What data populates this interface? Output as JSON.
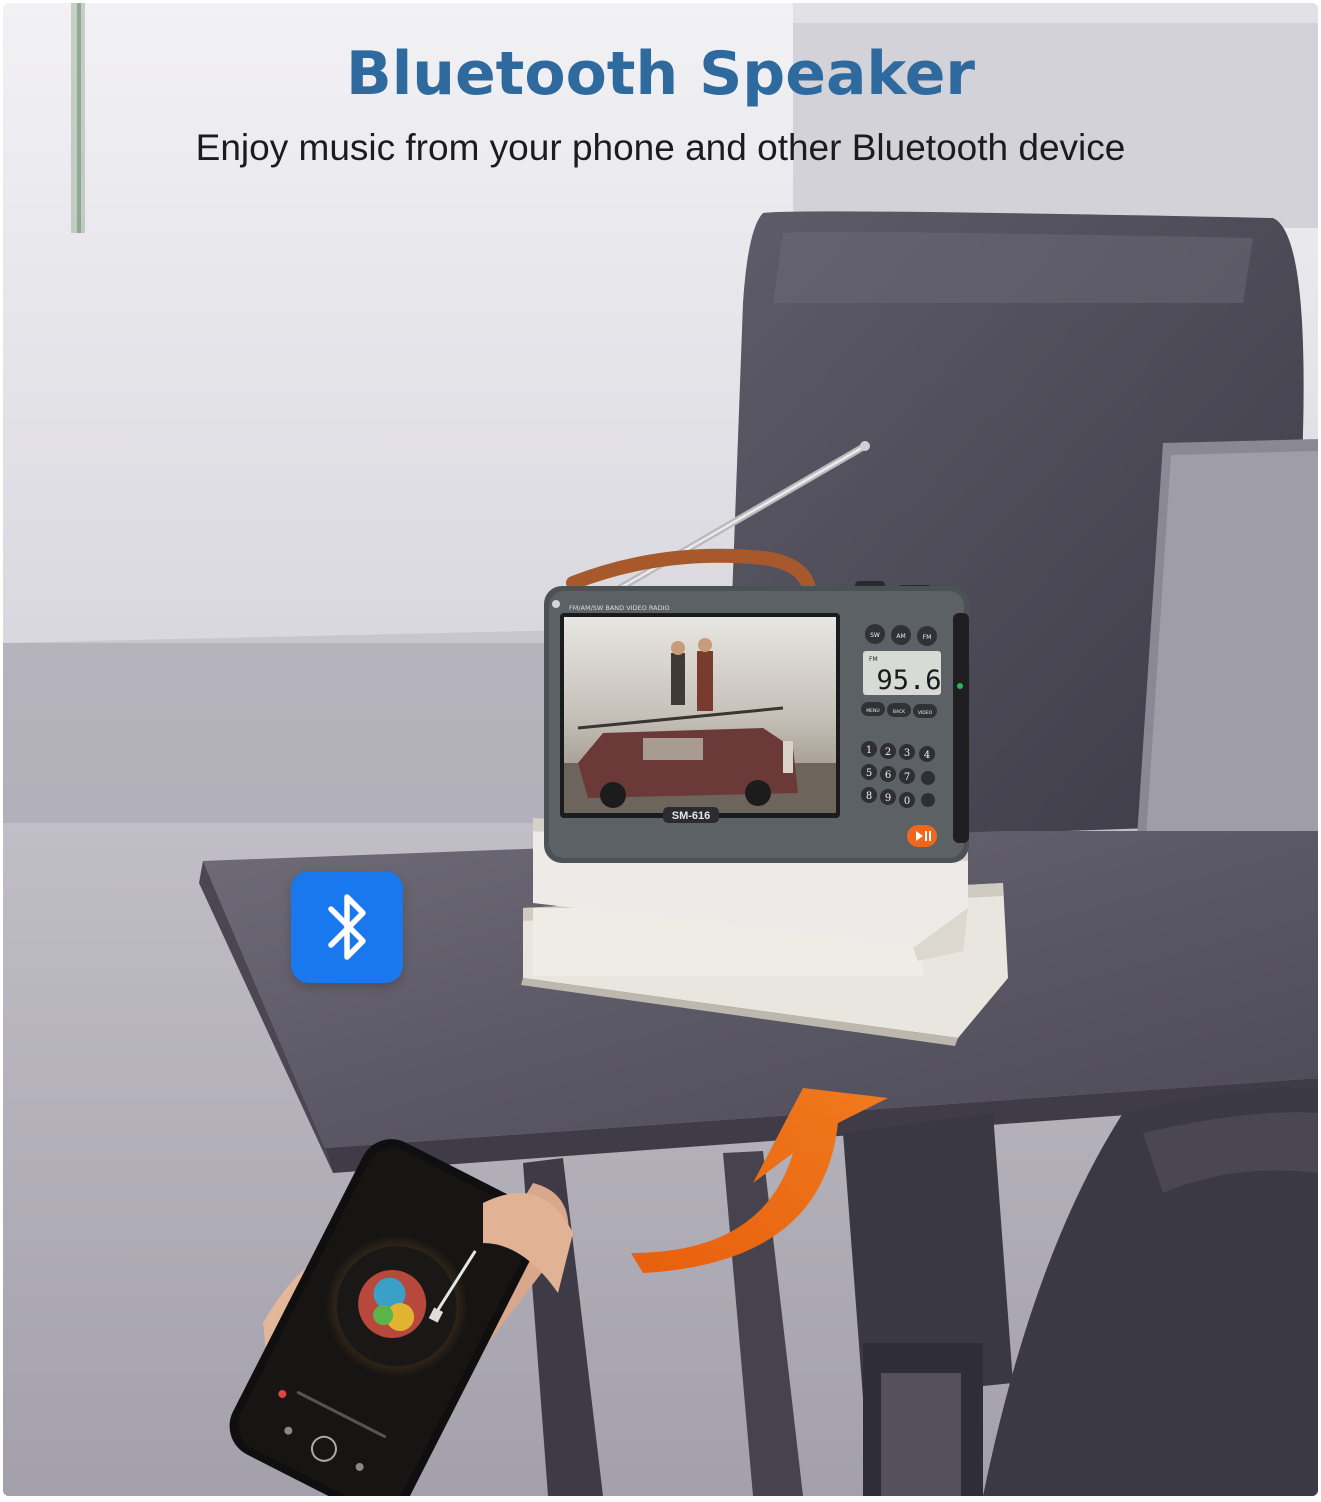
{
  "header": {
    "title": "Bluetooth Speaker",
    "subtitle": "Enjoy music from your phone and other Bluetooth device"
  },
  "radio": {
    "band_label": "FM/AM/SW BAND VIDEO RADIO",
    "model": "SM-616",
    "frequency": "95.6",
    "display_band": "FM",
    "band_buttons": [
      "SW",
      "AM",
      "FM"
    ],
    "function_buttons": [
      "MENU",
      "BACK",
      "VIDEO"
    ],
    "keypad": [
      "1",
      "2",
      "3",
      "4",
      "5",
      "6",
      "7",
      "8",
      "9",
      "0"
    ]
  },
  "icons": {
    "bluetooth_badge": "bluetooth-icon",
    "arrow": "curved-arrow-icon"
  },
  "colors": {
    "title": "#2f6a9e",
    "bluetooth_badge": "#1a78ee",
    "arrow": "#ef6a12",
    "play_button": "#f0671b"
  }
}
